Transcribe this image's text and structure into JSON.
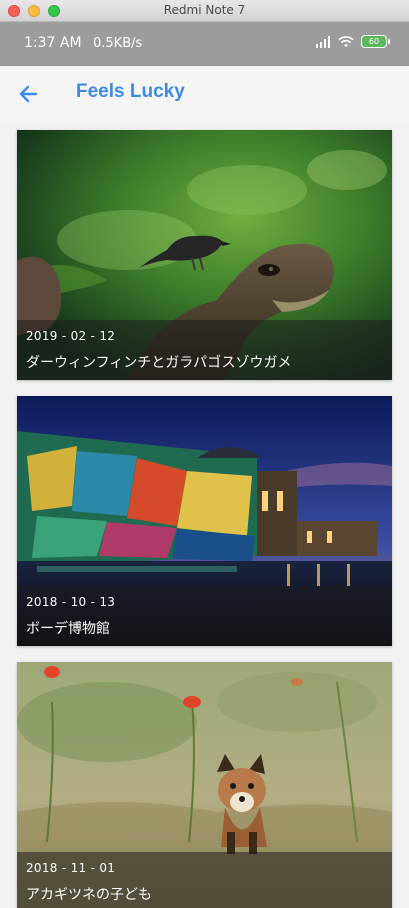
{
  "window": {
    "title": "Redmi Note 7"
  },
  "statusbar": {
    "time": "1:37 AM",
    "network_speed": "0.5KB/s",
    "battery": "60"
  },
  "appbar": {
    "title": "Feels Lucky"
  },
  "cards": [
    {
      "date": "2019 - 02 - 12",
      "title": "ダーウィンフィンチとガラパゴスゾウガメ"
    },
    {
      "date": "2018 - 10 - 13",
      "title": "ボーデ博物館"
    },
    {
      "date": "2018 - 11 - 01",
      "title": "アカギツネの子ども"
    }
  ]
}
